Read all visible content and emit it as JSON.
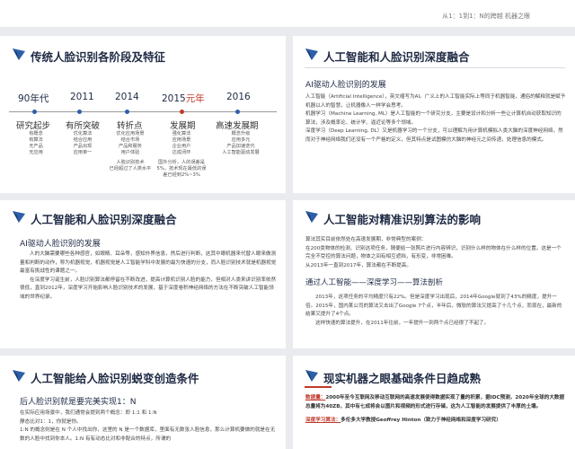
{
  "top_note": "从1：1到1：N的跨越     机器之眼",
  "slide1": {
    "title": "传统人脸识别各阶段及特征",
    "timeline": [
      {
        "year": "90年代",
        "year_hl": "",
        "stage": "研究起步",
        "desc": [
          "有概念",
          "有算法",
          "无产品",
          "无应用"
        ]
      },
      {
        "year": "2011",
        "year_hl": "",
        "stage": "有所突破",
        "desc": [
          "优化算法",
          "结合应用",
          "产品出现",
          "应用单一"
        ]
      },
      {
        "year": "2014",
        "year_hl": "",
        "stage": "转折点",
        "desc": [
          "优化应用场景",
          "结合市场",
          "产品和服务",
          "用户体验",
          "",
          "人脸识别技术",
          "已经超过了人类水平"
        ]
      },
      {
        "year": "2015",
        "year_hl": "元年",
        "stage": "发展期",
        "desc": [
          "强化算法",
          "应用场景",
          "企业用户",
          "达成闭环",
          "",
          "国外分析，人的误差是",
          "5%，技术现在最低的误",
          "差已经到2%~3%"
        ]
      },
      {
        "year": "2016",
        "year_hl": "",
        "stage": "高速发展期",
        "desc": [
          "概念升级",
          "应用多元",
          "产品加速迭代",
          "人工智能驱动发展"
        ]
      }
    ]
  },
  "slide2": {
    "title": "人工智能和人脸识别深度融合",
    "subtitle": "AI驱动人脸识别的发展",
    "paras": [
      "人工智能（Artificial Intelligence），英文缩写为AI。广义上的人工智能实际上等同于机器智能，通俗的解释就是赋予机器以人的智慧，让机器像人一样学会思考。",
      "机器学习（Machine Learning, ML）是人工智能的一个研究分支，主要是设计和分析一些让计算机自动获取知识的算法，涉及概率论、统计学、逼近论等多个领域。",
      "深度学习（Deep Learning, DL）又是机器学习的一个分支，可以理解为用计算机模拟人类大脑的深度神经网络，然而对于神经网络我们还没有一个严格的定义，但其特点是试图模仿大脑的神经元之间传递，处理信息的模式。"
    ]
  },
  "slide3": {
    "title": "人工智能和人脸识别深度融合",
    "subtitle": "AI驱动人脸识别的发展",
    "paras": [
      "人的大脑需要哪些各种感官，如眼睛、耳朵等，感知外界信息，然后进行判断，这其中眼机器来代替人眼来做测量和判断的动作，称为机器视觉，机器视觉是人工智能学科中发展的最为快速的分支，而人脸识别技术就是机器视觉最富有挑战性的课题之一。",
      "在深度学习诞生前，人脸识别算法都停留在不断改进，提高计算机识别人脸的能力，但相对人类来讲识别率依然很低，直到2012年，深度学习开始影响人脸识别技术的发展，基于深度卷积神经网络的方法在不断突破人工智能领域的世界纪录。"
    ]
  },
  "slide4": {
    "title": "人工智能对精准识别算法的影响",
    "p1": "算法其实目前依然处在高速发展期，非常典型的案例：",
    "p2": "在200类物体的检测、识别这项任务，随便给一张照片进行内容辨识，识别什么样的物体在什么样的位置。这是一个完全不受控的算法问题，物体之间有相互遮挡，有形变，非常困难。",
    "p3": "从2013年一直到2017年，算法都在不断提高。",
    "subtitle": "通过人工智能——深度学习——算法剖析",
    "p4": "2013年，这项任务的平均精度只有22%。但是深度学习出现后，2014年Google就到了43%的精度，提升一倍。2015年，国内某公司的算法又击出了Google 7个点，半年后，微软的算法又提高了十几个点，而现在，最新的结果又提升了4个点。",
    "p5": "这样快速的算法提升，在2011年往前，一年提升一到两个点已经很了不起了。"
  },
  "slide5": {
    "title": "人工智能给人脸识别蜕变创造条件",
    "subtitle": "后人脸识别就是要完美实现1：N",
    "p1": "在实际应用场景中，我们通常会提到两个概念：即 1:1 和 1:N",
    "p2": "静态比对1：1，你就是你。",
    "p3": "1:N 的概念则是在 N 个人中找出你，这里的 N 是一个数据库，里面有无数张人脸信息，那么计算机要做的就是在无数的人脸中找到你本人。1:N 有有动态比对和非配合的特点，所谓的"
  },
  "slide6": {
    "title": "现实机器之眼基础条件日趋成熟",
    "label1": "数据量：",
    "text1": "2000年至今互联网及移动互联网的高速发展使得数据实现了量的积累，据IDC预测，2020年全球的大数据总量将为40ZB，其中有七成将会以图片和视频的形式进行存储，这为人工智能的发展提供了丰厚的土壤。",
    "label2": "深度学习算法：",
    "text2": "多伦多大学教授Geoffrey Hinton（致力于神经网络和深度学习研究）"
  }
}
